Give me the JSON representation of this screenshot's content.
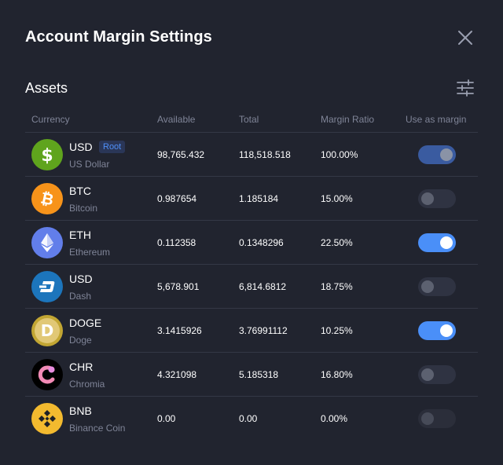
{
  "modal": {
    "title": "Account Margin Settings"
  },
  "assets": {
    "title": "Assets",
    "columns": {
      "currency": "Currency",
      "available": "Available",
      "total": "Total",
      "margin_ratio": "Margin Ratio",
      "use_as_margin": "Use as margin"
    },
    "rows": [
      {
        "symbol": "USD",
        "name": "US Dollar",
        "badge": "Root",
        "available": "98,765.432",
        "total": "118,518.518",
        "ratio": "100.00%",
        "use_as_margin": true,
        "toggle_state": "on-disabled",
        "icon": "usd-icon",
        "color": "#5fa41d"
      },
      {
        "symbol": "BTC",
        "name": "Bitcoin",
        "available": "0.987654",
        "total": "1.185184",
        "ratio": "15.00%",
        "use_as_margin": false,
        "toggle_state": "off",
        "icon": "bitcoin-icon",
        "color": "#f7931a"
      },
      {
        "symbol": "ETH",
        "name": "Ethereum",
        "available": "0.112358",
        "total": "0.1348296",
        "ratio": "22.50%",
        "use_as_margin": true,
        "toggle_state": "on",
        "icon": "ethereum-icon",
        "color": "#627eea"
      },
      {
        "symbol": "USD",
        "name": "Dash",
        "available": "5,678.901",
        "total": "6,814.6812",
        "ratio": "18.75%",
        "use_as_margin": false,
        "toggle_state": "off",
        "icon": "dash-icon",
        "color": "#1c75bc"
      },
      {
        "symbol": "DOGE",
        "name": "Doge",
        "available": "3.1415926",
        "total": "3.76991112",
        "ratio": "10.25%",
        "use_as_margin": true,
        "toggle_state": "on",
        "icon": "doge-icon",
        "color": "#c2a633"
      },
      {
        "symbol": "CHR",
        "name": "Chromia",
        "available": "4.321098",
        "total": "5.185318",
        "ratio": "16.80%",
        "use_as_margin": false,
        "toggle_state": "off",
        "icon": "chromia-icon",
        "color": "#000000"
      },
      {
        "symbol": "BNB",
        "name": "Binance Coin",
        "available": "0.00",
        "total": "0.00",
        "ratio": "0.00%",
        "use_as_margin": false,
        "toggle_state": "off-disabled",
        "icon": "binance-icon",
        "color": "#f3ba2f"
      }
    ]
  }
}
